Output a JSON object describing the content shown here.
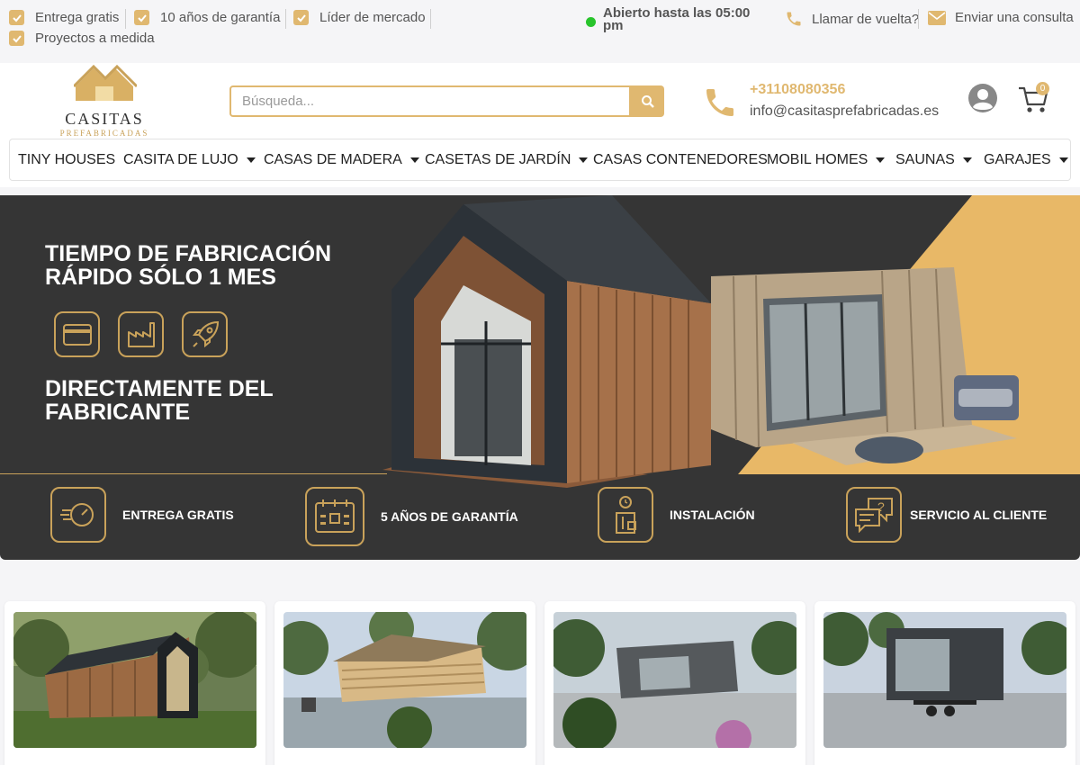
{
  "topbar": {
    "usps": [
      "Entrega gratis",
      "10 años de garantía",
      "Líder de mercado",
      "Proyectos a medida"
    ],
    "opening": "Abierto hasta las 05:00 pm",
    "callback": "Llamar de vuelta?",
    "enquiry": "Enviar una consulta"
  },
  "header": {
    "logo_name": "CASITAS",
    "logo_sub": "PREFABRICADAS",
    "search_placeholder": "Búsqueda...",
    "phone": "+31108080356",
    "email": "info@casitasprefabricadas.es",
    "cart_count": "0"
  },
  "nav": {
    "items": [
      "TINY HOUSES",
      "CASITA DE LUJO",
      "CASAS DE MADERA",
      "CASETAS DE JARDÍN",
      "CASAS CONTENEDORES",
      "MOBIL HOMES",
      "SAUNAS",
      "GARAJES"
    ]
  },
  "hero": {
    "headline": "TIEMPO DE FABRICACIÓN RÁPIDO SÓLO 1 MES",
    "subheadline": "DIRECTAMENTE DEL FABRICANTE",
    "features": [
      "ENTREGA GRATIS",
      "5 AÑOS DE GARANTÍA",
      "INSTALACIÓN",
      "SERVICIO AL CLIENTE"
    ]
  },
  "colors": {
    "accent": "#e0b870",
    "dark": "#353535",
    "open_status": "#28c42c"
  }
}
